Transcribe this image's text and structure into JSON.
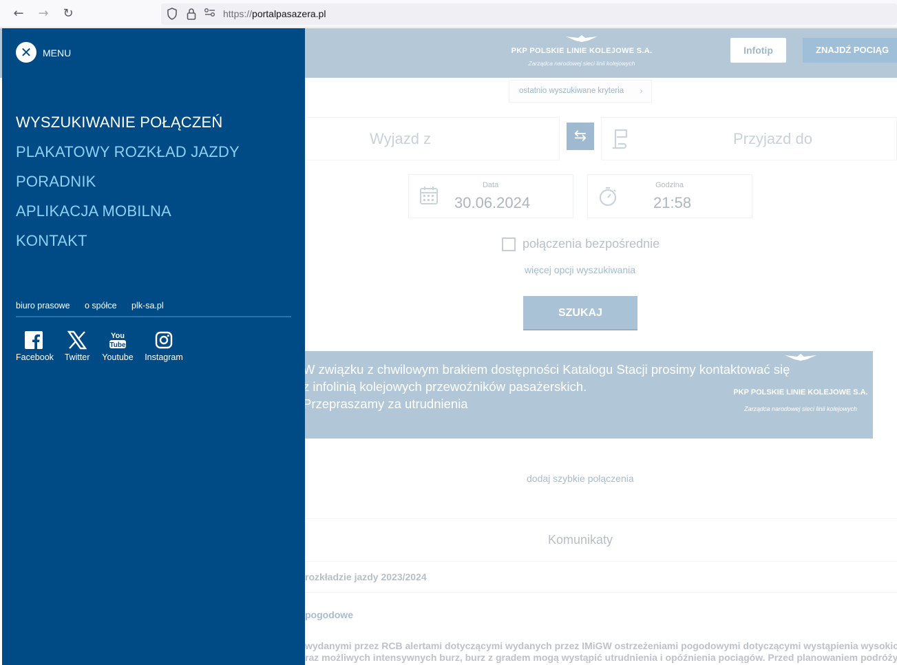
{
  "browser": {
    "url_protocol": "https://",
    "url_host": "portalpasazera.pl",
    "back_icon": "back-arrow-icon",
    "forward_icon": "forward-arrow-icon",
    "reload_icon": "reload-icon"
  },
  "header": {
    "logo_line1": "PKP POLSKIE LINIE KOLEJOWE S.A.",
    "logo_line2": "Zarządca narodowej sieci linii kolejowych",
    "infotip_label": "Infotip",
    "find_train_label": "ZNAJDŹ POCIĄG"
  },
  "search": {
    "recent_criteria": "ostatnio wyszukiwane kryteria",
    "from_placeholder": "Wyjazd z",
    "to_placeholder": "Przyjazd do",
    "date_label": "Data",
    "date_value": "30.06.2024",
    "time_label": "Godzina",
    "time_value": "21:58",
    "direct_label": "połączenia bezpośrednie",
    "more_options": "więcej opcji wyszukiwania",
    "search_button": "SZUKAJ"
  },
  "banner": {
    "line1": "W związku z chwilowym brakiem dostępności Katalogu Stacji prosimy kontaktować się",
    "line2": "z infolinią kolejowych przewoźników pasażerskich.",
    "line3": "Przepraszamy za utrudnienia",
    "logo_line1": "PKP POLSKIE LINIE KOLEJOWE S.A.",
    "logo_line2": "Zarządca narodowej sieci linii kolejowych"
  },
  "quick_add": "dodaj szybkie połączenia",
  "announcements": {
    "title": "Komunikaty",
    "item1": "rozkładzie jazdy 2023/2024",
    "item2": "pogodowe",
    "text_line1": "wydanymi przez RCB alertami dotyczącymi wydanych przez IMiGW ostrzeżeniami pogodowymi dotyczącymi wystąpienia wysokich",
    "text_line2": "raz możliwych intensywnych burz, burz z gradem mogą wystąpić utrudnienia i opóźnienia pociągów. Przed planowaniem podróży zaleca"
  },
  "menu": {
    "title": "MENU",
    "items": [
      {
        "label": "WYSZUKIWANIE POŁĄCZEŃ"
      },
      {
        "label": "PLAKATOWY ROZKŁAD JAZDY"
      },
      {
        "label": "PORADNIK"
      },
      {
        "label": "APLIKACJA MOBILNA"
      },
      {
        "label": "KONTAKT"
      }
    ],
    "links": [
      "biuro prasowe",
      "o spółce",
      "plk-sa.pl"
    ],
    "social": [
      {
        "label": "Facebook",
        "icon": "facebook-icon"
      },
      {
        "label": "Twitter",
        "icon": "twitter-x-icon"
      },
      {
        "label": "Youtube",
        "icon": "youtube-icon"
      },
      {
        "label": "Instagram",
        "icon": "instagram-icon"
      }
    ]
  },
  "colors": {
    "menu_bg": "#004b85",
    "menu_item": "#8fd0f4",
    "menu_active": "#ffffff"
  }
}
